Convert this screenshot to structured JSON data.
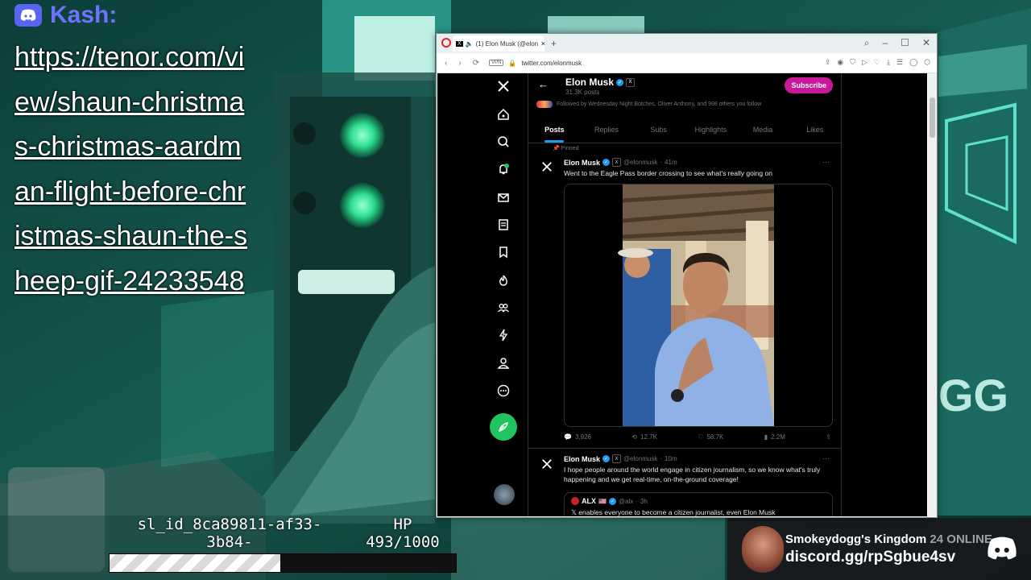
{
  "chat": {
    "username": "Kash:",
    "message": "https://tenor.com/view/shaun-christmas-christmas-aardman-flight-before-christmas-shaun-the-sheep-gif-24233548"
  },
  "hud": {
    "id_text": "sl_id_8ca89811-af33-3b84-",
    "hp_label": "HP",
    "hp_value": "493/1000",
    "hp_current": 493,
    "hp_max": 1000
  },
  "discord": {
    "server": "Smokeydogg's Kingdom",
    "online": "24 ONLINE",
    "invite": "discord.gg/rpSgbue4sv"
  },
  "browser": {
    "tab_title": "(1) Elon Musk (@elon",
    "url": "twitter.com/elonmusk",
    "vpn": "VPN"
  },
  "profile": {
    "name": "Elon Musk",
    "posts": "31.3K posts",
    "subscribe": "Subscribe",
    "followed_by": "Followed by Wednesday Night Botches, Oliver Anthony, and 998 others you follow",
    "tabs": [
      "Posts",
      "Replies",
      "Subs",
      "Highlights",
      "Media",
      "Likes"
    ],
    "active_tab": "Posts"
  },
  "tweets": [
    {
      "pinned": "Pinned",
      "name": "Elon Musk",
      "handle": "@elonmusk",
      "time": "41m",
      "text": "Went to the Eagle Pass border crossing to see what's really going on",
      "replies": "3,926",
      "reposts": "12.7K",
      "likes": "58.7K",
      "views": "2.2M"
    },
    {
      "name": "Elon Musk",
      "handle": "@elonmusk",
      "time": "10m",
      "text": "I hope people around the world engage in citizen journalism, so we know what's truly happening and we get real-time, on-the-ground coverage!",
      "quote": {
        "name": "ALX",
        "flags": "🇺🇸",
        "handle": "@alx",
        "time": "3h",
        "text": "𝕏 enables everyone to become a citizen journalist, even Elon Musk"
      }
    }
  ],
  "colors": {
    "accent": "#1d9bf0",
    "subscribe": "#c9199a",
    "compose": "#1fc35f",
    "discord": "#5865f2"
  }
}
